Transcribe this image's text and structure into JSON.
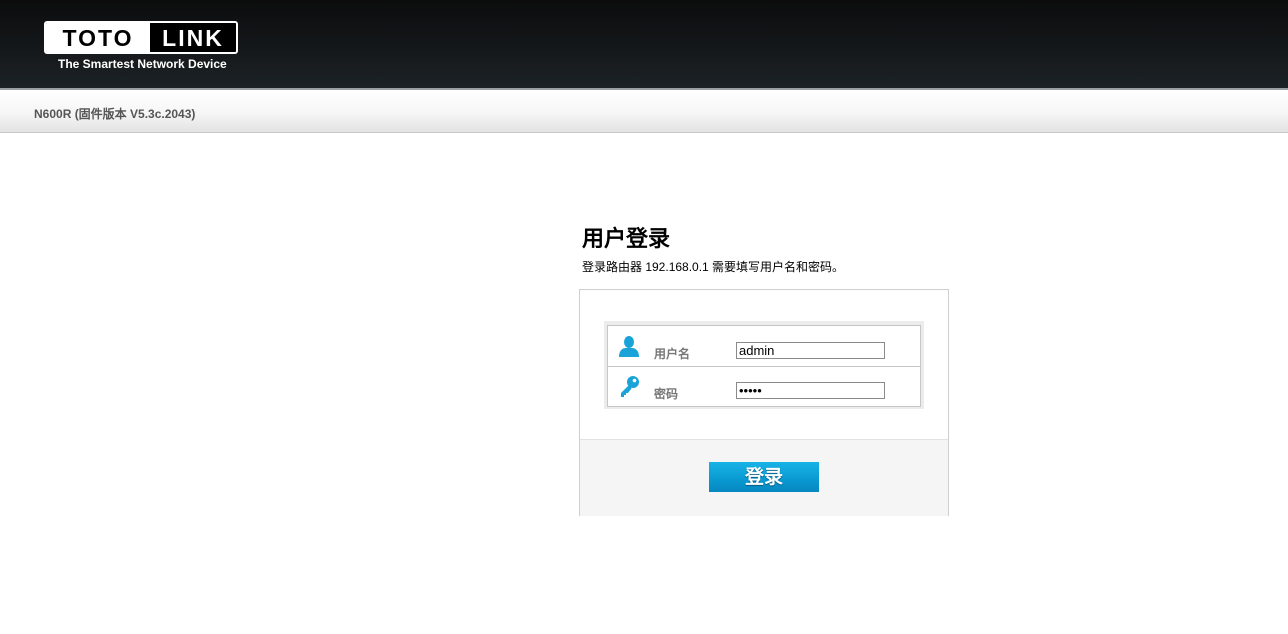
{
  "brand": {
    "logo_left": "TOTO",
    "logo_right": "LINK",
    "tagline": "The Smartest Network Device"
  },
  "header": {
    "version": "N600R (固件版本 V5.3c.2043)"
  },
  "login": {
    "title": "用户登录",
    "description": "登录路由器 192.168.0.1 需要填写用户名和密码。",
    "username_label": "用户名",
    "username_value": "admin",
    "username_icon": "user-icon",
    "password_label": "密码",
    "password_value": "admin",
    "password_icon": "key-icon",
    "submit_label": "登录"
  },
  "colors": {
    "accent": "#0a9bd3",
    "icon": "#1aa3d8",
    "header_bg": "#111519"
  }
}
